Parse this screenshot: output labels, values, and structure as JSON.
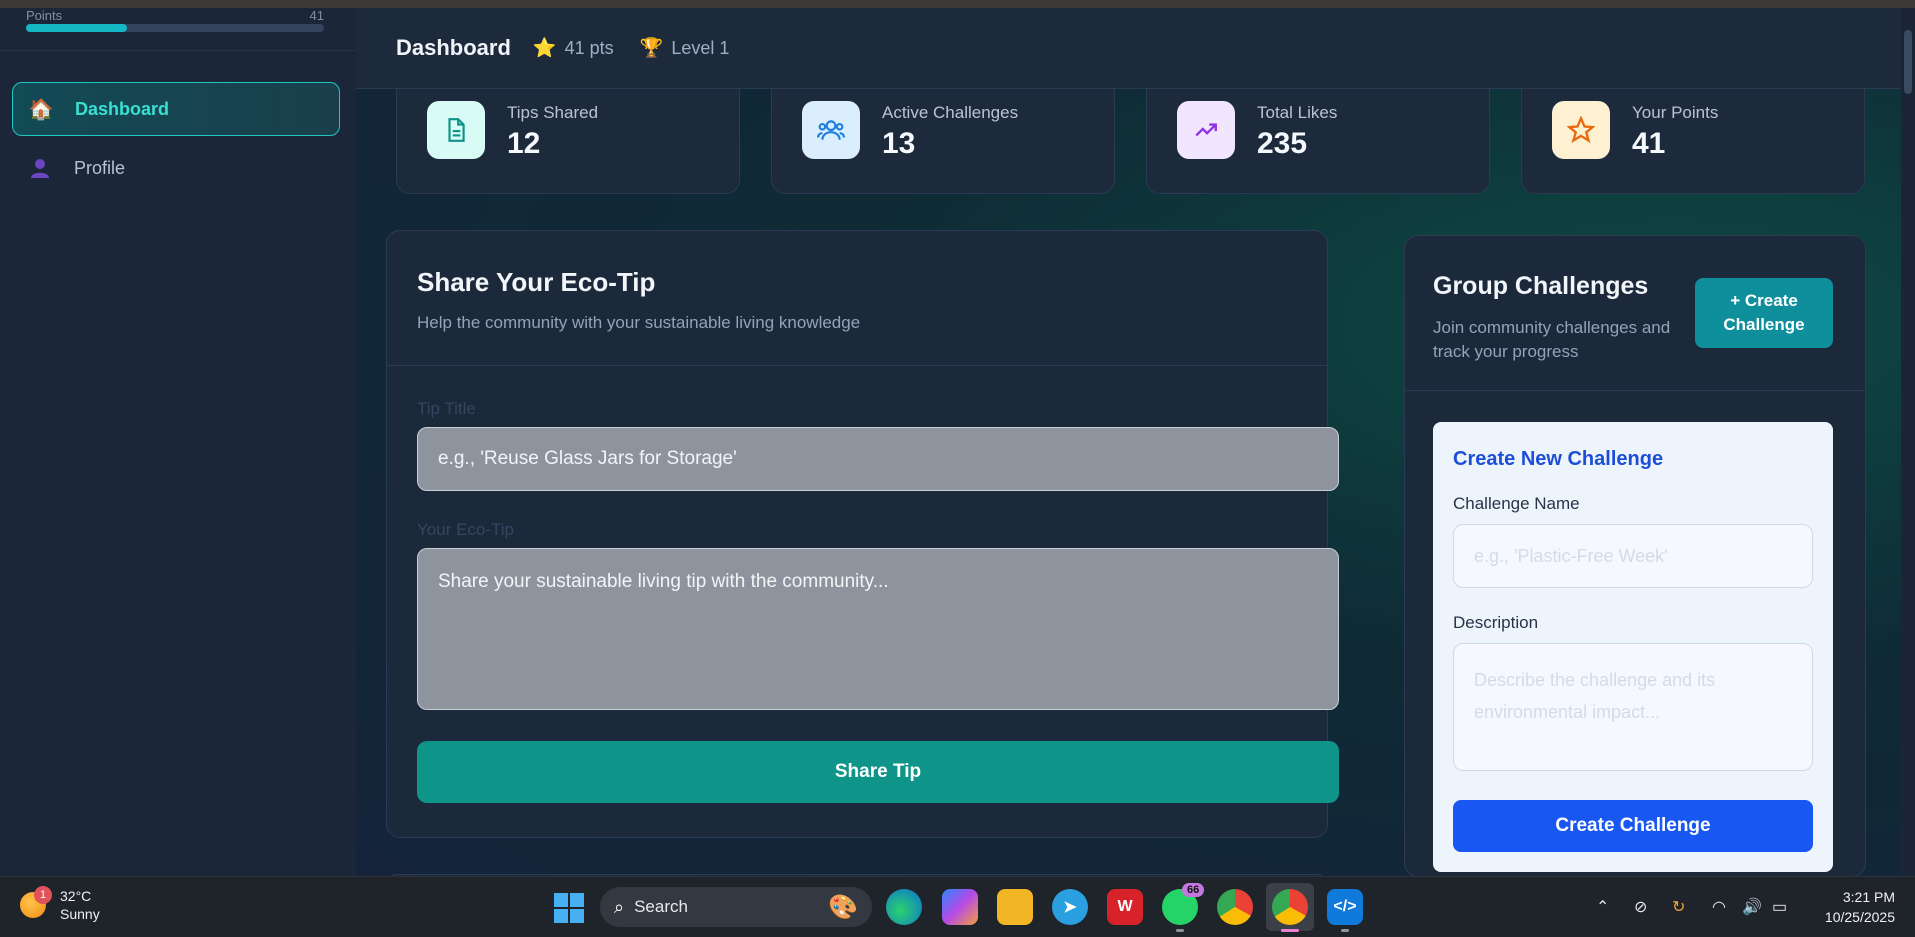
{
  "sidebar": {
    "progress_label": "Points",
    "progress_value_label": "41",
    "progress_fraction": 0.34,
    "items": [
      {
        "label": "Dashboard",
        "icon": "house-icon",
        "active": true
      },
      {
        "label": "Profile",
        "icon": "person-icon",
        "active": false
      }
    ]
  },
  "header": {
    "title": "Dashboard",
    "points": "41 pts",
    "level": "Level 1"
  },
  "stats": [
    {
      "label": "Tips Shared",
      "value": "12",
      "icon": "document-icon",
      "bg": "#d9fbf6",
      "color": "#0d9488"
    },
    {
      "label": "Active Challenges",
      "value": "13",
      "icon": "users-icon",
      "bg": "#dbeefe",
      "color": "#1d7fe0"
    },
    {
      "label": "Total Likes",
      "value": "235",
      "icon": "trending-up-icon",
      "bg": "#f2e6ff",
      "color": "#9333ea"
    },
    {
      "label": "Your Points",
      "value": "41",
      "icon": "star-icon",
      "bg": "#fdf1d2",
      "color": "#ea6a0b"
    }
  ],
  "tip_form": {
    "title": "Share Your Eco-Tip",
    "subtitle": "Help the community with your sustainable living knowledge",
    "title_label": "Tip Title",
    "title_placeholder": "e.g., 'Reuse Glass Jars for Storage'",
    "tip_label": "Your Eco-Tip",
    "tip_placeholder": "Share your sustainable living tip with the community...",
    "submit_label": "Share Tip"
  },
  "challenges": {
    "title": "Group Challenges",
    "subtitle": "Join community challenges and track your progress",
    "create_button": "+ Create Challenge",
    "form": {
      "title": "Create New Challenge",
      "name_label": "Challenge Name",
      "name_placeholder": "e.g., 'Plastic-Free Week'",
      "desc_label": "Description",
      "desc_placeholder": "Describe the challenge and its environmental impact...",
      "submit_label": "Create Challenge"
    }
  },
  "taskbar": {
    "weather_temp": "32°C",
    "weather_desc": "Sunny",
    "weather_badge": "1",
    "search_label": "Search",
    "whatsapp_badge": "66",
    "time": "3:21 PM",
    "date": "10/25/2025"
  },
  "colors": {
    "accent_teal": "#0e9488",
    "accent_blue": "#1857f2",
    "sidebar_active": "#38e0d0"
  }
}
